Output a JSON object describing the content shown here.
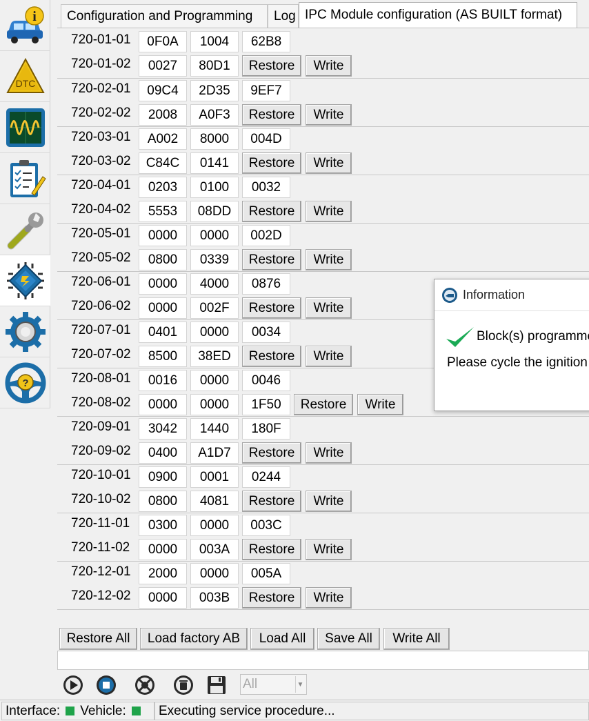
{
  "tabs": [
    {
      "label": "Configuration and Programming",
      "active": false
    },
    {
      "label": "Log",
      "active": false
    },
    {
      "label": "IPC Module configuration (AS BUILT format)",
      "active": true
    }
  ],
  "sidebar": {
    "items": [
      {
        "name": "vehicle-info",
        "icon": "car-info-icon",
        "text": "i"
      },
      {
        "name": "dtc",
        "icon": "dtc-warning-icon",
        "text": "DTC"
      },
      {
        "name": "oscilloscope",
        "icon": "oscilloscope-icon"
      },
      {
        "name": "checklist",
        "icon": "checklist-icon"
      },
      {
        "name": "service",
        "icon": "wrench-icon"
      },
      {
        "name": "module-programming",
        "icon": "chip-icon",
        "active": true
      },
      {
        "name": "settings",
        "icon": "gear-icon"
      },
      {
        "name": "help",
        "icon": "help-steering-icon",
        "text": "?"
      }
    ]
  },
  "blocks": [
    {
      "rows": [
        {
          "addr": "720-01-01",
          "values": [
            "0F0A",
            "1004",
            "62B8"
          ],
          "buttons": false
        },
        {
          "addr": "720-01-02",
          "values": [
            "0027",
            "80D1"
          ],
          "buttons": true
        }
      ]
    },
    {
      "rows": [
        {
          "addr": "720-02-01",
          "values": [
            "09C4",
            "2D35",
            "9EF7"
          ],
          "buttons": false
        },
        {
          "addr": "720-02-02",
          "values": [
            "2008",
            "A0F3"
          ],
          "buttons": true
        }
      ]
    },
    {
      "rows": [
        {
          "addr": "720-03-01",
          "values": [
            "A002",
            "8000",
            "004D"
          ],
          "buttons": false
        },
        {
          "addr": "720-03-02",
          "values": [
            "C84C",
            "0141"
          ],
          "buttons": true
        }
      ]
    },
    {
      "rows": [
        {
          "addr": "720-04-01",
          "values": [
            "0203",
            "0100",
            "0032"
          ],
          "buttons": false
        },
        {
          "addr": "720-04-02",
          "values": [
            "5553",
            "08DD"
          ],
          "buttons": true
        }
      ]
    },
    {
      "rows": [
        {
          "addr": "720-05-01",
          "values": [
            "0000",
            "0000",
            "002D"
          ],
          "buttons": false
        },
        {
          "addr": "720-05-02",
          "values": [
            "0800",
            "0339"
          ],
          "buttons": true
        }
      ]
    },
    {
      "rows": [
        {
          "addr": "720-06-01",
          "values": [
            "0000",
            "4000",
            "0876"
          ],
          "buttons": false
        },
        {
          "addr": "720-06-02",
          "values": [
            "0000",
            "002F"
          ],
          "buttons": true
        }
      ]
    },
    {
      "rows": [
        {
          "addr": "720-07-01",
          "values": [
            "0401",
            "0000",
            "0034"
          ],
          "buttons": false
        },
        {
          "addr": "720-07-02",
          "values": [
            "8500",
            "38ED"
          ],
          "buttons": true
        }
      ]
    },
    {
      "rows": [
        {
          "addr": "720-08-01",
          "values": [
            "0016",
            "0000",
            "0046"
          ],
          "buttons": false
        },
        {
          "addr": "720-08-02",
          "values": [
            "0000",
            "0000",
            "1F50"
          ],
          "buttons": true
        }
      ]
    },
    {
      "rows": [
        {
          "addr": "720-09-01",
          "values": [
            "3042",
            "1440",
            "180F"
          ],
          "buttons": false
        },
        {
          "addr": "720-09-02",
          "values": [
            "0400",
            "A1D7"
          ],
          "buttons": true
        }
      ]
    },
    {
      "rows": [
        {
          "addr": "720-10-01",
          "values": [
            "0900",
            "0001",
            "0244"
          ],
          "buttons": false
        },
        {
          "addr": "720-10-02",
          "values": [
            "0800",
            "4081"
          ],
          "buttons": true
        }
      ]
    },
    {
      "rows": [
        {
          "addr": "720-11-01",
          "values": [
            "0300",
            "0000",
            "003C"
          ],
          "buttons": false
        },
        {
          "addr": "720-11-02",
          "values": [
            "0000",
            "003A"
          ],
          "buttons": true
        }
      ]
    },
    {
      "rows": [
        {
          "addr": "720-12-01",
          "values": [
            "2000",
            "0000",
            "005A"
          ],
          "buttons": false
        },
        {
          "addr": "720-12-02",
          "values": [
            "0000",
            "003B"
          ],
          "buttons": true
        }
      ]
    }
  ],
  "row_buttons": {
    "restore": "Restore",
    "write": "Write"
  },
  "bottom_buttons": {
    "restore_all": "Restore All",
    "load_factory_ab": "Load factory AB",
    "load_all": "Load All",
    "save_all": "Save All",
    "write_all": "Write All"
  },
  "toolbar": {
    "icons": [
      "play-icon",
      "stop-icon",
      "help-lifebuoy-icon",
      "delete-icon",
      "save-icon"
    ],
    "filter_value": "All"
  },
  "statusbar": {
    "interface_label": "Interface:",
    "vehicle_label": "Vehicle:",
    "message": "Executing service procedure..."
  },
  "dialog": {
    "title": "Information",
    "message": "Block(s) programmed successfully",
    "instruction": "Please cycle the ignition"
  },
  "colors": {
    "ok_green": "#1fa34a",
    "check_green": "#1aaa55",
    "icon_blue": "#1a5f9e"
  }
}
